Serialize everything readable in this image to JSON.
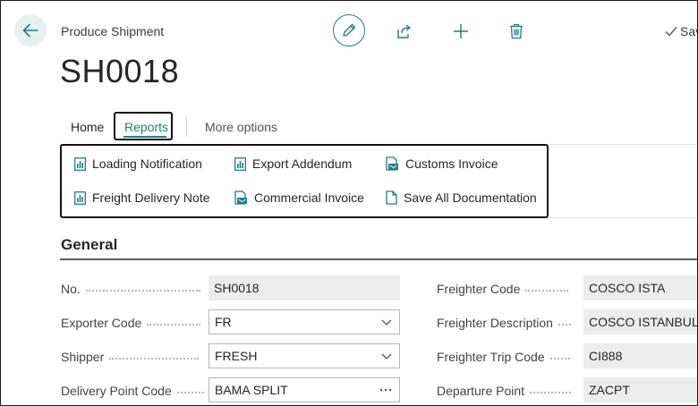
{
  "header": {
    "caption": "Produce Shipment",
    "record_no": "SH0018",
    "save_label": "Sav"
  },
  "tabs": {
    "home": "Home",
    "reports": "Reports",
    "more": "More options"
  },
  "reports": [
    {
      "label": "Loading Notification",
      "icon": "report-icon"
    },
    {
      "label": "Export Addendum",
      "icon": "report-icon"
    },
    {
      "label": "Customs Invoice",
      "icon": "document-stack-icon"
    },
    {
      "label": "Freight Delivery Note",
      "icon": "report-icon"
    },
    {
      "label": "Commercial Invoice",
      "icon": "document-stack-icon"
    },
    {
      "label": "Save All Documentation",
      "icon": "document-icon"
    }
  ],
  "general": {
    "title": "General",
    "left": [
      {
        "label": "No.",
        "value": "SH0018"
      },
      {
        "label": "Exporter Code",
        "value": "FR"
      },
      {
        "label": "Shipper",
        "value": "FRESH"
      },
      {
        "label": "Delivery Point Code",
        "value": "BAMA SPLIT"
      }
    ],
    "right": [
      {
        "label": "Freighter Code",
        "value": "COSCO ISTA"
      },
      {
        "label": "Freighter Description",
        "value": "COSCO ISTANBUL"
      },
      {
        "label": "Freighter Trip Code",
        "value": "CI888"
      },
      {
        "label": "Departure Point",
        "value": "ZACPT"
      }
    ]
  },
  "colors": {
    "accent": "#1e7f8a",
    "back_button_bg": "#e6f1f2"
  }
}
